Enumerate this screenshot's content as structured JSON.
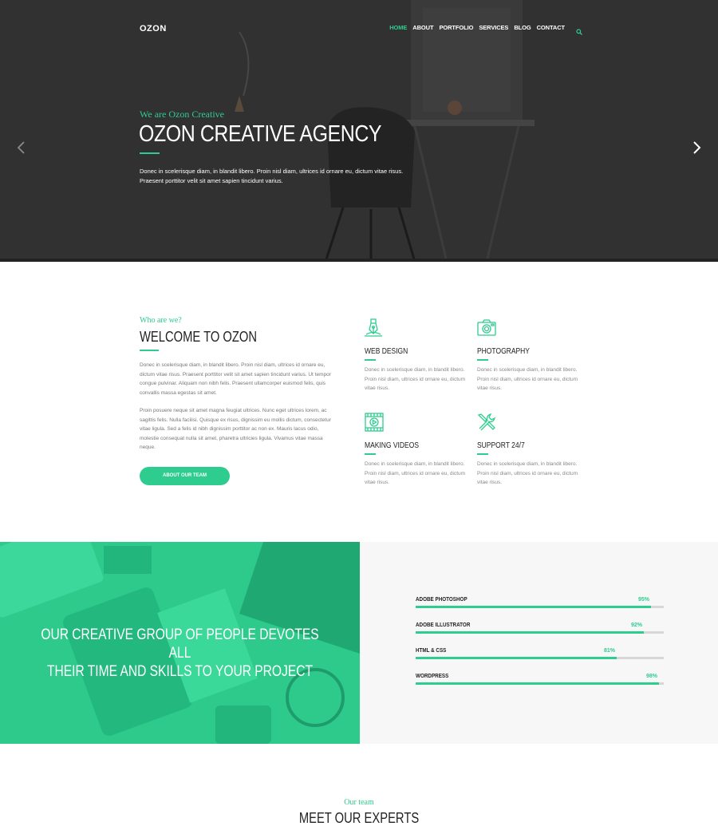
{
  "nav": {
    "logo": "OZON",
    "items": [
      {
        "label": "HOME",
        "active": true
      },
      {
        "label": "ABOUT",
        "active": false
      },
      {
        "label": "PORTFOLIO",
        "active": false
      },
      {
        "label": "SERVICES",
        "active": false
      },
      {
        "label": "BLOG",
        "active": false
      },
      {
        "label": "CONTACT",
        "active": false
      }
    ],
    "search_icon": "search-icon"
  },
  "hero": {
    "subtitle": "We are Ozon Creative",
    "title": "OZON CREATIVE AGENCY",
    "text": "Donec in scelerisque diam, in blandit libero. Proin nisl diam, ultrices id ornare eu, dictum vitae risus. Praesent porttitor velit sit amet sapien tincidunt varius.",
    "prev_icon": "chevron-left-icon",
    "next_icon": "chevron-right-icon"
  },
  "about": {
    "subtitle": "Who are we?",
    "title": "WELCOME TO OZON",
    "paragraph1": "Donec in scelerisque diam, in blandit libero. Proin nisl diam, ultrices id ornare eu, dictum vitae risus. Praesent porttitor velit sit amet sapien tincidunt varius. Ut tempor congue pulvinar. Aliquam non nibh felis. Praesent ullamcorper euismod felis, quis convallis massa egestas sit amet.",
    "paragraph2": "Proin posuere neque sit amet magna feugiat ultrices. Nunc eget ultrices lorem, ac sagittis felis. Nulla facilisi. Quisque ex risus, dignissim eu mollis dictum, consectetur vitae ligula. Sed a felis id nibh dignissim porttitor ac non ex. Mauris lacus odio, molestie consequat nulla sit amet, pharetra ultricies ligula. Vivamus vitae massa neque.",
    "button": "ABOUT OUR TEAM"
  },
  "services": [
    {
      "title": "WEB DESIGN",
      "icon": "pen-tool-icon",
      "text": "Donec in scelerisque diam, in blandit libero. Proin nisl diam, ultrices id ornare eu, dictum vitae risus."
    },
    {
      "title": "PHOTOGRAPHY",
      "icon": "camera-icon",
      "text": "Donec in scelerisque diam, in blandit libero. Proin nisl diam, ultrices id ornare eu, dictum vitae risus."
    },
    {
      "title": "MAKING VIDEOS",
      "icon": "film-icon",
      "text": "Donec in scelerisque diam, in blandit libero. Proin nisl diam, ultrices id ornare eu, dictum vitae risus."
    },
    {
      "title": "SUPPORT 24/7",
      "icon": "tools-icon",
      "text": "Donec in scelerisque diam, in blandit libero. Proin nisl diam, ultrices id ornare eu, dictum vitae risus."
    }
  ],
  "skills_panel": {
    "headline_line1": "OUR CREATIVE GROUP OF PEOPLE DEVOTES ALL",
    "headline_line2": "THEIR TIME AND SKILLS TO YOUR PROJECT",
    "skills": [
      {
        "name": "ADOBE PHOTOSHOP",
        "percent_label": "95%",
        "value": 95
      },
      {
        "name": "ADOBE ILLUSTRATOR",
        "percent_label": "92%",
        "value": 92
      },
      {
        "name": "HTML & CSS",
        "percent_label": "81%",
        "value": 81
      },
      {
        "name": "WORDPRESS",
        "percent_label": "98%",
        "value": 98
      }
    ]
  },
  "team": {
    "subtitle": "Our team",
    "title": "MEET OUR EXPERTS"
  },
  "colors": {
    "accent": "#2ecc8f",
    "hero_bg": "#2f2f2f",
    "panel_grey": "#f7f7f7"
  }
}
